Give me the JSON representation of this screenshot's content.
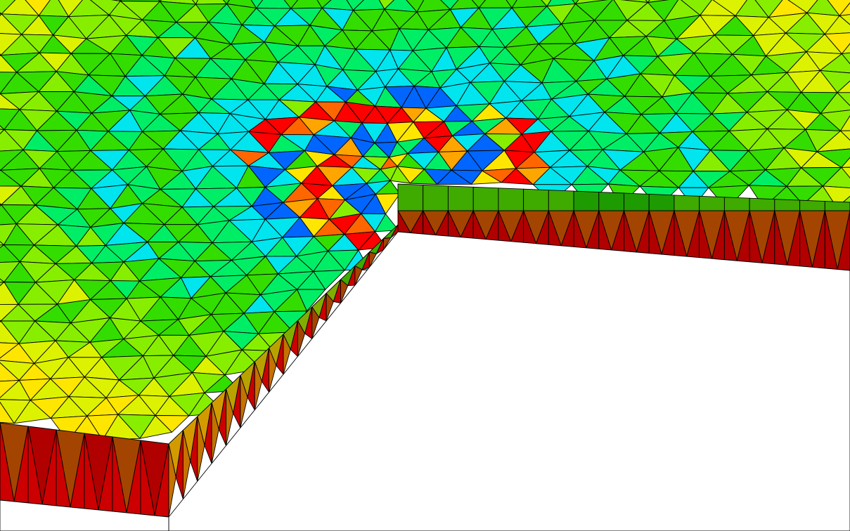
{
  "colors": {
    "background": "#ffffff",
    "edge": "#000000",
    "contour_scale": [
      "#0066ff",
      "#00e5ee",
      "#00ee66",
      "#33dd00",
      "#88ee00",
      "#ffe600",
      "#ffa500",
      "#ff6600",
      "#ff0000"
    ],
    "top_base": [
      "#ffe600",
      "#ddf200",
      "#88ee00",
      "#33dd00",
      "#00ee66"
    ],
    "side_faces": [
      "#cc0000",
      "#b00000",
      "#a34500",
      "#c47200",
      "#d39a00",
      "#b9a200",
      "#7fae00",
      "#3faa00",
      "#1d9b00"
    ]
  }
}
